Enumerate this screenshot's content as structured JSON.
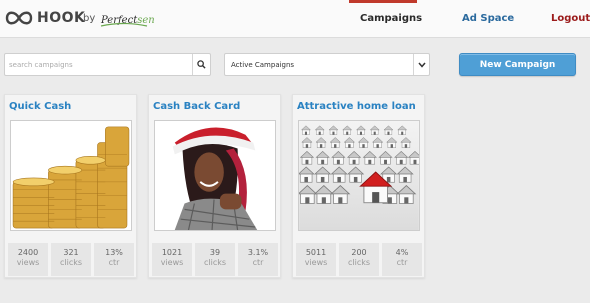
{
  "header": {
    "logo_text": "HOOK",
    "by": "by",
    "brand_a": "Perfect",
    "brand_b": "sen",
    "nav": {
      "campaigns": "Campaigns",
      "ad_space": "Ad Space",
      "logout": "Logout"
    },
    "active_nav": "Campaigns"
  },
  "toolbar": {
    "search_placeholder": "search campaigns",
    "filter_value": "Active Campaigns",
    "new_campaign_label": "New Campaign"
  },
  "colors": {
    "accent_blue": "#4f9fd6",
    "title_blue": "#2a82c2",
    "nav_active_bar": "#c0392b",
    "logout": "#9b1b1b"
  },
  "campaigns": [
    {
      "title": "Quick Cash",
      "image": "gold-coins-image",
      "stats": [
        {
          "value": "2400",
          "label": "views"
        },
        {
          "value": "321",
          "label": "clicks"
        },
        {
          "value": "13%",
          "label": "ctr"
        }
      ]
    },
    {
      "title": "Cash Back Card",
      "image": "woman-santa-hat-image",
      "stats": [
        {
          "value": "1021",
          "label": "views"
        },
        {
          "value": "39",
          "label": "clicks"
        },
        {
          "value": "3.1%",
          "label": "ctr"
        }
      ]
    },
    {
      "title": "Attractive home loan",
      "image": "houses-red-roof-image",
      "stats": [
        {
          "value": "5011",
          "label": "views"
        },
        {
          "value": "200",
          "label": "clicks"
        },
        {
          "value": "4%",
          "label": "ctr"
        }
      ]
    }
  ]
}
